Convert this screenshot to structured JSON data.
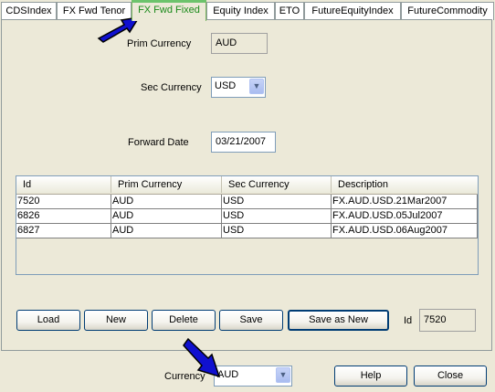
{
  "tabs": [
    {
      "label": "CDSIndex"
    },
    {
      "label": "FX Fwd Tenor"
    },
    {
      "label": "FX Fwd Fixed"
    },
    {
      "label": "Equity Index"
    },
    {
      "label": "ETO"
    },
    {
      "label": "FutureEquityIndex"
    },
    {
      "label": "FutureCommodity"
    }
  ],
  "form": {
    "prim_currency_label": "Prim Currency",
    "prim_currency_value": "AUD",
    "sec_currency_label": "Sec Currency",
    "sec_currency_value": "USD",
    "forward_date_label": "Forward Date",
    "forward_date_value": "03/21/2007"
  },
  "table": {
    "columns": [
      "Id",
      "Prim Currency",
      "Sec Currency",
      "Description"
    ],
    "rows": [
      [
        "7520",
        "AUD",
        "USD",
        "FX.AUD.USD.21Mar2007"
      ],
      [
        "6826",
        "AUD",
        "USD",
        "FX.AUD.USD.05Jul2007"
      ],
      [
        "6827",
        "AUD",
        "USD",
        "FX.AUD.USD.06Aug2007"
      ]
    ]
  },
  "actions": {
    "load": "Load",
    "new": "New",
    "delete": "Delete",
    "save": "Save",
    "save_as_new": "Save as New",
    "id_label": "Id",
    "id_value": "7520"
  },
  "footer": {
    "currency_label": "Currency",
    "currency_value": "AUD",
    "help": "Help",
    "close": "Close"
  },
  "colors": {
    "active_tab": "#1a8a1a",
    "pointer_arrow": "#1010d0"
  },
  "icons": [
    "dropdown-arrow-icon",
    "pointer-arrow-icon"
  ]
}
